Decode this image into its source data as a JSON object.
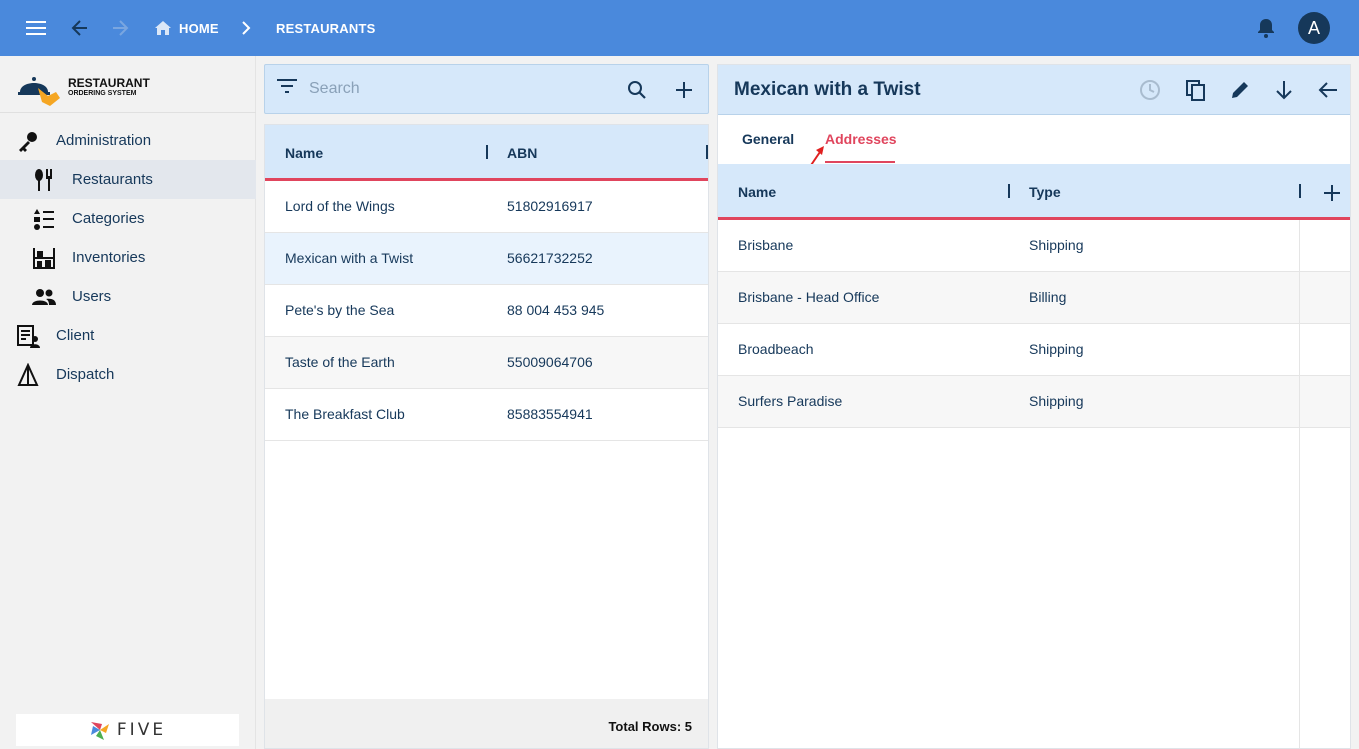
{
  "topbar": {
    "breadcrumb_home": "HOME",
    "breadcrumb_current": "RESTAURANTS",
    "avatar_letter": "A",
    "accent_color": "#4a89dc"
  },
  "sidebar": {
    "logo_title": "RESTAURANT",
    "logo_subtitle": "ORDERING SYSTEM",
    "items": [
      {
        "label": "Administration",
        "icon": "key-icon"
      },
      {
        "label": "Restaurants",
        "icon": "utensils-icon",
        "active": true
      },
      {
        "label": "Categories",
        "icon": "list-icon"
      },
      {
        "label": "Inventories",
        "icon": "shelves-icon"
      },
      {
        "label": "Users",
        "icon": "users-icon"
      },
      {
        "label": "Client",
        "icon": "client-icon"
      },
      {
        "label": "Dispatch",
        "icon": "dispatch-icon"
      }
    ],
    "footer_brand": "FIVE"
  },
  "list": {
    "search_placeholder": "Search",
    "columns": [
      "Name",
      "ABN"
    ],
    "rows": [
      {
        "name": "Lord of the Wings",
        "abn": "51802916917"
      },
      {
        "name": "Mexican with a Twist",
        "abn": "56621732252"
      },
      {
        "name": "Pete's by the Sea",
        "abn": "88 004 453 945"
      },
      {
        "name": "Taste of the Earth",
        "abn": "55009064706"
      },
      {
        "name": "The Breakfast Club",
        "abn": "85883554941"
      }
    ],
    "total_rows": "Total Rows: 5"
  },
  "detail": {
    "title": "Mexican with a Twist",
    "tabs": [
      "General",
      "Addresses"
    ],
    "active_tab": "Addresses",
    "columns": [
      "Name",
      "Type"
    ],
    "rows": [
      {
        "name": "Brisbane",
        "type": "Shipping"
      },
      {
        "name": "Brisbane - Head Office",
        "type": "Billing"
      },
      {
        "name": "Broadbeach",
        "type": "Shipping"
      },
      {
        "name": "Surfers Paradise",
        "type": "Shipping"
      }
    ],
    "highlight_color": "#e0455d"
  }
}
